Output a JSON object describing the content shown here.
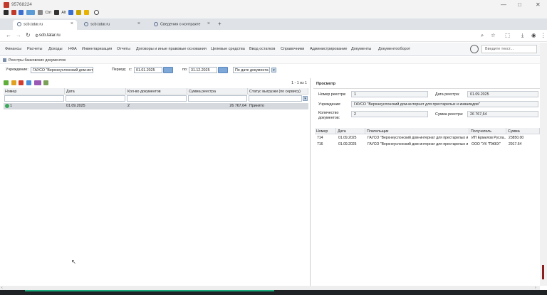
{
  "window": {
    "title": "95768224",
    "controls": [
      "—",
      "□",
      "✕"
    ]
  },
  "quickbar": {
    "items": [
      "Ctrl",
      "Alt"
    ]
  },
  "tabs": [
    {
      "label": "scb.tatar.ru",
      "icon": "globe-icon"
    },
    {
      "label": "scb.tatar.ru",
      "icon": "globe-icon"
    },
    {
      "label": "Сведения о контракте",
      "icon": "globe-icon"
    }
  ],
  "new_tab": "+",
  "address": {
    "url": "scb.tatar.ru"
  },
  "menu": {
    "items": [
      "Финансы",
      "Расчеты",
      "Доходы",
      "НФА",
      "Инвентаризация",
      "Отчеты",
      "Договоры и иные правовые основания",
      "Целевые средства",
      "Ввод остатков",
      "Справочники",
      "Администрирование",
      "Документы",
      "Документооборот"
    ],
    "search_placeholder": "Введите текст..."
  },
  "breadcrumb": "Реестры банковских документов",
  "filter": {
    "institution_label": "Учреждение:",
    "institution_value": "ГАУСО \"Верхнеуслонский дом-интк",
    "period_label": "Период:",
    "from_label": "с:",
    "from_value": "01.01.2025",
    "to_label": "по:",
    "to_value": "31.12.2025",
    "sort_value": "По дате документа"
  },
  "grid": {
    "pager": "1 - 1 из 1",
    "columns": [
      "Номер",
      "Дата",
      "Кол-во документов",
      "Сумма реестра",
      "Статус выгрузки (по сервису)"
    ],
    "rows": [
      [
        "1",
        "01.09.2025",
        "2",
        "26 767,64",
        "Принято"
      ]
    ]
  },
  "view": {
    "title": "Просмотр",
    "registry_number_label": "Номер реестра:",
    "registry_number": "1",
    "registry_date_label": "Дата реестра:",
    "registry_date": "01.09.2025",
    "institution_label": "Учреждение:",
    "institution_value": "ГАУСО \"Верхнеуслонский дом-интернат для престарелых и инвалидов\"",
    "doc_count_label_1": "Количество",
    "doc_count_label_2": "документов:",
    "doc_count": "2",
    "sum_label": "Сумма реестра:",
    "sum_value": "26 767,64",
    "doc_columns": [
      "Номер",
      "Дата",
      "Плательщик",
      "Получатель",
      "Сумма"
    ],
    "doc_rows": [
      [
        "714",
        "01.09.2025",
        "ГАУСО \"Верхнеуслонский дом-интернат для престарелых и и...",
        "ИП Ермилов Русла...",
        "23850.00"
      ],
      [
        "716",
        "01.09.2025",
        "ГАУСО \"Верхнеуслонский дом-интернат для престарелых и и...",
        "ООО \"УК \"ПЖКХ\"",
        "2917.64"
      ]
    ]
  }
}
